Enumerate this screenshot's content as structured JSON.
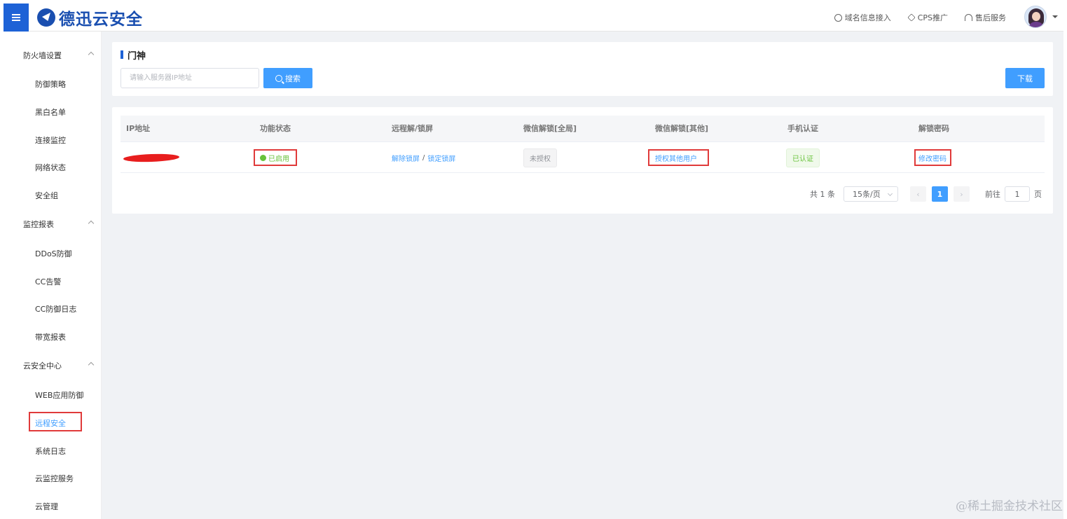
{
  "header": {
    "logo_text": "德迅云安全",
    "links": [
      {
        "label": "域名信息接入",
        "icon": "globe-icon"
      },
      {
        "label": "CPS推广",
        "icon": "cube-icon"
      },
      {
        "label": "售后服务",
        "icon": "headset-icon"
      }
    ]
  },
  "sidebar": {
    "groups": [
      {
        "label": "防火墙设置",
        "items": [
          "防御策略",
          "黑白名单",
          "连接监控",
          "网络状态",
          "安全组"
        ]
      },
      {
        "label": "监控报表",
        "items": [
          "DDoS防御",
          "CC告警",
          "CC防御日志",
          "带宽报表"
        ]
      },
      {
        "label": "云安全中心",
        "items": [
          "WEB应用防御",
          "远程安全",
          "系统日志",
          "云监控服务",
          "云管理"
        ]
      }
    ],
    "active_item": "远程安全"
  },
  "page": {
    "title": "门神",
    "search_placeholder": "请输入服务器IP地址",
    "search_label": "搜索",
    "download_label": "下载"
  },
  "table": {
    "columns": [
      "IP地址",
      "功能状态",
      "远程解/锁屏",
      "微信解锁[全局]",
      "微信解锁[其他]",
      "手机认证",
      "解锁密码"
    ],
    "rows": [
      {
        "ip": "",
        "status": "已启用",
        "unlock_label": "解除锁屏",
        "separator": "/",
        "lock_label": "锁定锁屏",
        "wechat_global": "未授权",
        "wechat_other": "授权其他用户",
        "phone_auth": "已认证",
        "password": "修改密码"
      }
    ]
  },
  "pagination": {
    "total": "共 1 条",
    "page_size": "15条/页",
    "current_page": "1",
    "goto_label": "前往",
    "goto_value": "1",
    "page_suffix": "页"
  },
  "watermark": "@稀土掘金技术社区",
  "colors": {
    "primary": "#409eff",
    "brand": "#1a4fb0",
    "success": "#67c23a",
    "highlight_box": "#e03a3a"
  }
}
